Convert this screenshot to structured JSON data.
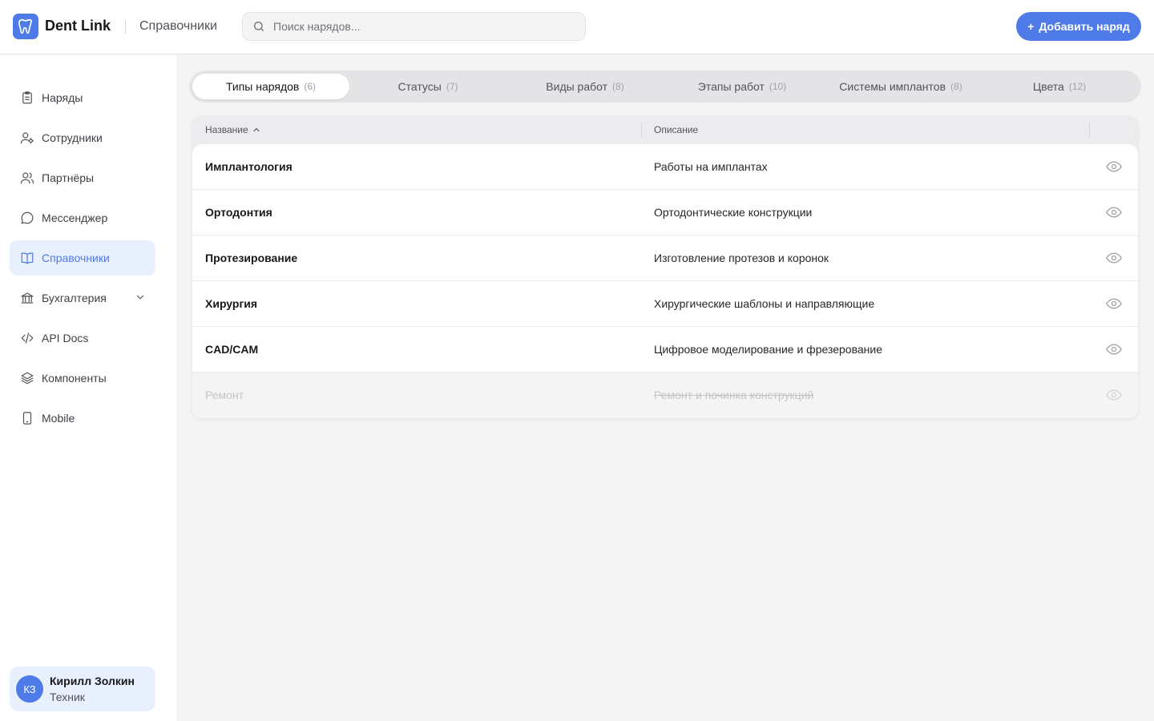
{
  "header": {
    "app_name": "Dent Link",
    "section": "Справочники",
    "search_placeholder": "Поиск нарядов...",
    "add_button_label": "Добавить наряд",
    "brand_color": "#4f7be8"
  },
  "sidebar": {
    "items": [
      {
        "label": "Наряды",
        "icon": "clipboard-icon",
        "active": false
      },
      {
        "label": "Сотрудники",
        "icon": "user-gear-icon",
        "active": false
      },
      {
        "label": "Партнёры",
        "icon": "users-icon",
        "active": false
      },
      {
        "label": "Мессенджер",
        "icon": "chat-icon",
        "active": false
      },
      {
        "label": "Справочники",
        "icon": "book-icon",
        "active": true
      },
      {
        "label": "Бухгалтерия",
        "icon": "bank-icon",
        "active": false
      },
      {
        "label": "API Docs",
        "icon": "code-icon",
        "active": false
      },
      {
        "label": "Компоненты",
        "icon": "layers-icon",
        "active": false
      },
      {
        "label": "Mobile",
        "icon": "phone-icon",
        "active": false
      }
    ],
    "user": {
      "initials": "КЗ",
      "name": "Кирилл Золкин",
      "role": "Техник"
    }
  },
  "tabs": [
    {
      "label": "Типы нарядов",
      "count": "(6)",
      "active": true
    },
    {
      "label": "Статусы",
      "count": "(7)",
      "active": false
    },
    {
      "label": "Виды работ",
      "count": "(8)",
      "active": false
    },
    {
      "label": "Этапы работ",
      "count": "(10)",
      "active": false
    },
    {
      "label": "Системы имплантов",
      "count": "(8)",
      "active": false
    },
    {
      "label": "Цвета",
      "count": "(12)",
      "active": false
    }
  ],
  "table": {
    "columns": {
      "name": "Название",
      "description": "Описание"
    },
    "rows": [
      {
        "name": "Имплантология",
        "description": "Работы на имплантах",
        "disabled": false
      },
      {
        "name": "Ортодонтия",
        "description": "Ортодонтические конструкции",
        "disabled": false
      },
      {
        "name": "Протезирование",
        "description": "Изготовление протезов и коронок",
        "disabled": false
      },
      {
        "name": "Хирургия",
        "description": "Хирургические шаблоны и направляющие",
        "disabled": false
      },
      {
        "name": "CAD/CAM",
        "description": "Цифровое моделирование и фрезерование",
        "disabled": false
      },
      {
        "name": "Ремонт",
        "description": "Ремонт и починка конструкций",
        "disabled": true
      }
    ]
  }
}
